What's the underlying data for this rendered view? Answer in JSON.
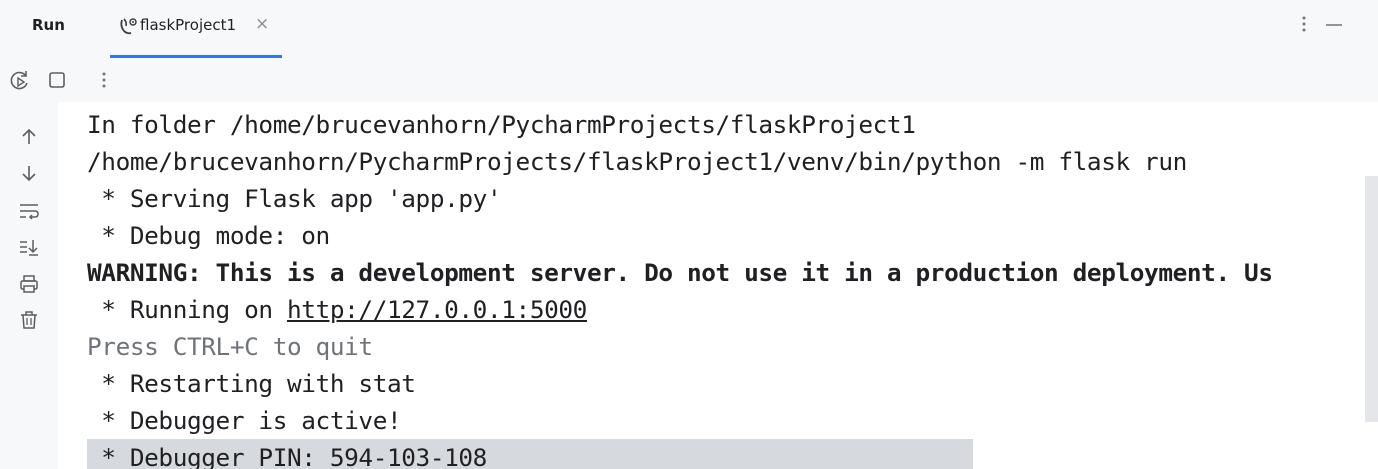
{
  "header": {
    "title": "Run",
    "tab": {
      "label": "flaskProject1",
      "icon": "flask-run-icon",
      "close_icon": "close-icon",
      "close_glyph": "×"
    },
    "more_icon": "more-vertical-icon",
    "minimize_icon": "minimize-icon"
  },
  "toolbar": {
    "rerun_icon": "rerun-icon",
    "stop_icon": "stop-icon",
    "more_icon": "more-vertical-icon"
  },
  "sidebar": {
    "icons": [
      "arrow-up-icon",
      "arrow-down-icon",
      "soft-wrap-icon",
      "scroll-to-end-icon",
      "print-icon",
      "trash-icon"
    ]
  },
  "console": {
    "lines": [
      {
        "text": "In folder /home/brucevanhorn/PycharmProjects/flaskProject1"
      },
      {
        "text": "/home/brucevanhorn/PycharmProjects/flaskProject1/venv/bin/python -m flask run"
      },
      {
        "text": " * Serving Flask app 'app.py'"
      },
      {
        "text": " * Debug mode: on"
      },
      {
        "text": "WARNING: This is a development server. Do not use it in a production deployment. Us"
      },
      {
        "prefix": " * Running on ",
        "link": "http://127.0.0.1:5000"
      },
      {
        "text": "Press CTRL+C to quit"
      },
      {
        "text": " * Restarting with stat"
      },
      {
        "text": " * Debugger is active!"
      },
      {
        "text": " * Debugger PIN: 594-103-108"
      }
    ]
  },
  "colors": {
    "background": "#f7f8fa",
    "console_bg": "#ffffff",
    "tab_underline": "#3574f0",
    "text": "#1f2023",
    "muted_text": "#6f737a",
    "selection": "#d6d9de"
  }
}
